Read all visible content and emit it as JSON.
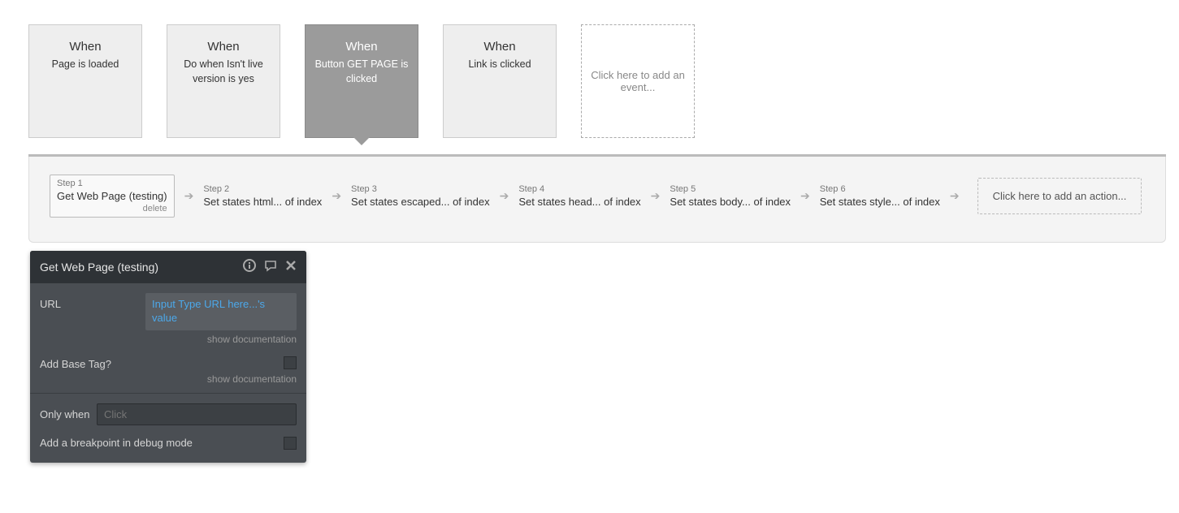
{
  "events": [
    {
      "title": "When",
      "desc": "Page is loaded",
      "selected": false
    },
    {
      "title": "When",
      "desc": "Do when Isn't live version is yes",
      "selected": false
    },
    {
      "title": "When",
      "desc": "Button GET PAGE is clicked",
      "selected": true
    },
    {
      "title": "When",
      "desc": "Link is clicked",
      "selected": false
    }
  ],
  "add_event_text": "Click here to add an event...",
  "steps": [
    {
      "label": "Step 1",
      "text": "Get Web Page (testing)",
      "delete": "delete",
      "selected": true
    },
    {
      "label": "Step 2",
      "text": "Set states html... of index",
      "selected": false
    },
    {
      "label": "Step 3",
      "text": "Set states escaped... of index",
      "selected": false
    },
    {
      "label": "Step 4",
      "text": "Set states head... of index",
      "selected": false
    },
    {
      "label": "Step 5",
      "text": "Set states body... of index",
      "selected": false
    },
    {
      "label": "Step 6",
      "text": "Set states style... of index",
      "selected": false
    }
  ],
  "add_action_text": "Click here to add an action...",
  "panel": {
    "title": "Get Web Page (testing)",
    "url_label": "URL",
    "url_value": "Input Type URL here...'s value",
    "show_documentation": "show documentation",
    "add_base_tag_label": "Add Base Tag?",
    "only_when_label": "Only when",
    "only_when_placeholder": "Click",
    "breakpoint_label": "Add a breakpoint in debug mode"
  }
}
